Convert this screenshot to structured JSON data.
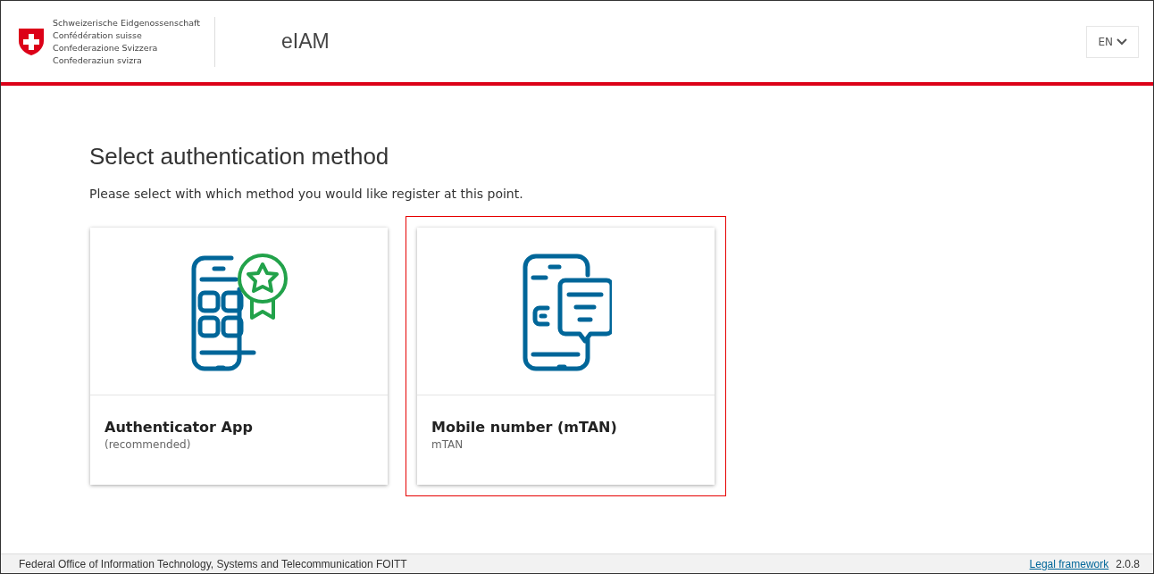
{
  "header": {
    "federation_names": [
      "Schweizerische Eidgenossenschaft",
      "Confédération suisse",
      "Confederazione Svizzera",
      "Confederaziun svizra"
    ],
    "app_name": "eIAM",
    "language": "EN"
  },
  "page": {
    "title": "Select authentication method",
    "description": "Please select with which method you would like register at this point."
  },
  "methods": [
    {
      "kind": "app",
      "title": "Authenticator App",
      "subtitle": "(recommended)",
      "selected": false
    },
    {
      "kind": "sms",
      "title": "Mobile number (mTAN)",
      "subtitle": "mTAN",
      "selected": true
    }
  ],
  "footer": {
    "office": "Federal Office of Information Technology, Systems and Telecommunication FOITT",
    "link": "Legal framework",
    "version": "2.0.8"
  }
}
